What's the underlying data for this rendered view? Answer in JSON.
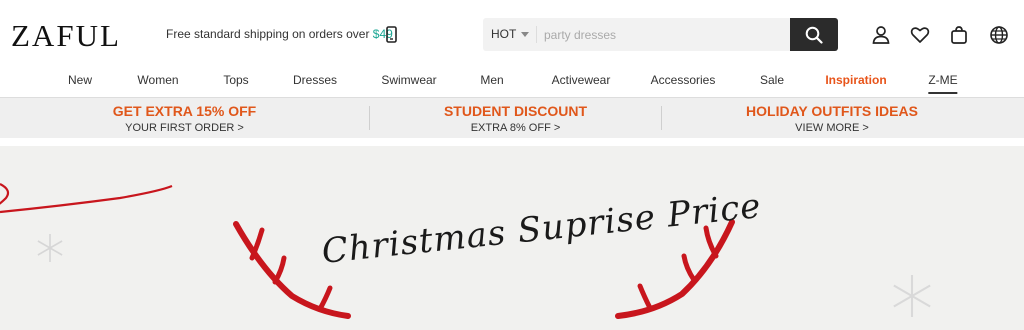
{
  "header": {
    "logo": "ZAFUL",
    "shipping_text": "Free standard shipping on orders over ",
    "shipping_amount": "$49",
    "search": {
      "category": "HOT",
      "placeholder": "party dresses"
    }
  },
  "nav": {
    "items": [
      {
        "label": "New"
      },
      {
        "label": "Women"
      },
      {
        "label": "Tops"
      },
      {
        "label": "Dresses"
      },
      {
        "label": "Swimwear"
      },
      {
        "label": "Men"
      },
      {
        "label": "Activewear"
      },
      {
        "label": "Accessories"
      },
      {
        "label": "Sale"
      },
      {
        "label": "Inspiration"
      },
      {
        "label": "Z-ME"
      }
    ]
  },
  "promo": [
    {
      "title": "GET EXTRA 15% OFF",
      "subtitle": "YOUR FIRST ORDER >"
    },
    {
      "title": "STUDENT DISCOUNT",
      "subtitle": "EXTRA 8% OFF >"
    },
    {
      "title": "HOLIDAY OUTFITS IDEAS",
      "subtitle": "VIEW MORE >"
    }
  ],
  "banner": {
    "title": "Christmas Suprise Price"
  },
  "colors": {
    "accent": "#e0571b",
    "shipping_amount": "#1aa693",
    "search_button": "#2b2b2b",
    "antler_red": "#c8161d"
  },
  "icons": [
    "phone-icon",
    "search-icon",
    "account-icon",
    "heart-icon",
    "bag-icon",
    "globe-icon",
    "snowflake-icon"
  ]
}
